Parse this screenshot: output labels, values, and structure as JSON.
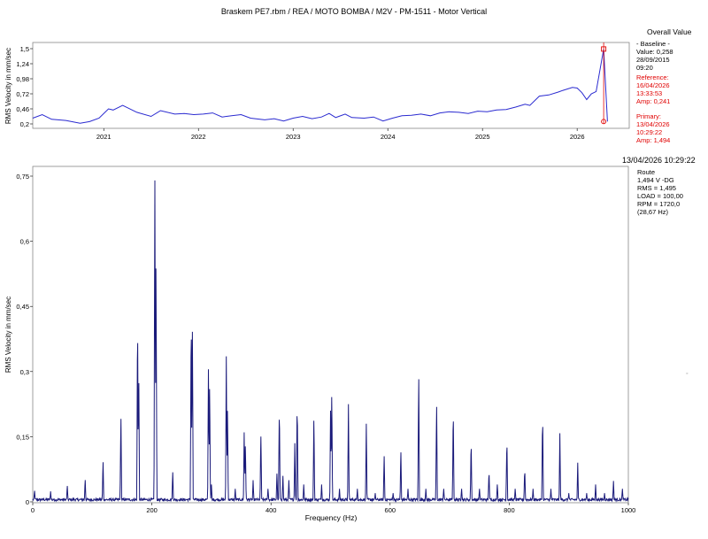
{
  "window_title": "Braskem PE7.rbm / REA / MOTO BOMBA / M2V - PM-1511 - Motor Vertical",
  "overall_label": "Overall Value",
  "baseline": {
    "title": "- Baseline -",
    "value": "Value: 0,258",
    "date": "28/09/2015",
    "time": "09:20"
  },
  "reference": {
    "title": "Reference:",
    "date": "16/04/2026",
    "time": "13:33:53",
    "amp": "Amp: 0,241"
  },
  "primary": {
    "title": "Primary:",
    "date": "13/04/2026",
    "time": "10:29:22",
    "amp": "Amp: 1,494"
  },
  "spectrum_timestamp": "13/04/2026 10:29:22",
  "spectrum_info": {
    "line1": "Route",
    "line2": "1,494 V -DG",
    "line3": "RMS = 1,495",
    "line4": "LOAD = 100,00",
    "line5": "RPM = 1720,0",
    "line6": "(28,67 Hz)"
  },
  "colors": {
    "trend_line": "#2a2ad0",
    "spectrum_line": "#1a1a7a",
    "marker": "#e00000",
    "reference_text": "#e00000"
  },
  "chart_data": [
    {
      "type": "line",
      "ylabel": "RMS Velocity in mm/sec",
      "ylim": [
        0.2,
        1.5
      ],
      "yticks": [
        "1,5",
        "1,24",
        "0,98",
        "0,72",
        "0,46",
        "0,2"
      ],
      "ytick_values": [
        1.5,
        1.24,
        0.98,
        0.72,
        0.46,
        0.2
      ],
      "xlim": [
        2020.25,
        2026.55
      ],
      "xticks": [
        "2021",
        "2022",
        "2023",
        "2024",
        "2025",
        "2026"
      ],
      "xtick_values": [
        2021,
        2022,
        2023,
        2024,
        2025,
        2026
      ],
      "x": [
        2020.25,
        2020.35,
        2020.45,
        2020.6,
        2020.75,
        2020.85,
        2020.95,
        2021.05,
        2021.1,
        2021.2,
        2021.35,
        2021.5,
        2021.6,
        2021.75,
        2021.85,
        2021.95,
        2022.05,
        2022.15,
        2022.25,
        2022.35,
        2022.45,
        2022.55,
        2022.7,
        2022.8,
        2022.9,
        2023.0,
        2023.1,
        2023.2,
        2023.3,
        2023.38,
        2023.45,
        2023.55,
        2023.62,
        2023.75,
        2023.85,
        2023.95,
        2024.05,
        2024.15,
        2024.25,
        2024.35,
        2024.45,
        2024.55,
        2024.65,
        2024.75,
        2024.85,
        2024.95,
        2025.05,
        2025.15,
        2025.25,
        2025.35,
        2025.45,
        2025.5,
        2025.6,
        2025.7,
        2025.8,
        2025.85,
        2025.95,
        2026.0,
        2026.05,
        2026.1,
        2026.15,
        2026.2,
        2026.28,
        2026.32
      ],
      "values": [
        0.3,
        0.36,
        0.28,
        0.26,
        0.21,
        0.24,
        0.3,
        0.46,
        0.44,
        0.52,
        0.4,
        0.33,
        0.43,
        0.37,
        0.38,
        0.36,
        0.37,
        0.39,
        0.32,
        0.34,
        0.36,
        0.3,
        0.27,
        0.29,
        0.25,
        0.3,
        0.33,
        0.29,
        0.32,
        0.38,
        0.31,
        0.37,
        0.31,
        0.3,
        0.32,
        0.25,
        0.3,
        0.34,
        0.35,
        0.37,
        0.34,
        0.39,
        0.41,
        0.4,
        0.38,
        0.42,
        0.41,
        0.44,
        0.45,
        0.49,
        0.54,
        0.52,
        0.68,
        0.7,
        0.75,
        0.78,
        0.83,
        0.82,
        0.74,
        0.62,
        0.72,
        0.76,
        1.494,
        0.241
      ],
      "baseline_value": 0.258
    },
    {
      "type": "line",
      "xlabel": "Frequency (Hz)",
      "ylabel": "RMS Velocity in mm/sec",
      "xlim": [
        0,
        1000
      ],
      "ylim": [
        0,
        0.75
      ],
      "xticks": [
        "0",
        "200",
        "400",
        "600",
        "800",
        "1000"
      ],
      "xtick_values": [
        0,
        200,
        400,
        600,
        800,
        1000
      ],
      "yticks": [
        "0,75",
        "0,6",
        "0,45",
        "0,3",
        "0,15",
        "0"
      ],
      "ytick_values": [
        0.75,
        0.6,
        0.45,
        0.3,
        0.15,
        0
      ],
      "peaks": [
        [
          3,
          0.028
        ],
        [
          30,
          0.024
        ],
        [
          58,
          0.04
        ],
        [
          88,
          0.055
        ],
        [
          118,
          0.1
        ],
        [
          148,
          0.21
        ],
        [
          176,
          0.445
        ],
        [
          178,
          0.3
        ],
        [
          205,
          0.74
        ],
        [
          207,
          0.59
        ],
        [
          235,
          0.068
        ],
        [
          266,
          0.455
        ],
        [
          268,
          0.43
        ],
        [
          295,
          0.305
        ],
        [
          297,
          0.285
        ],
        [
          325,
          0.335
        ],
        [
          327,
          0.23
        ],
        [
          355,
          0.16
        ],
        [
          357,
          0.14
        ],
        [
          383,
          0.165
        ],
        [
          410,
          0.065
        ],
        [
          414,
          0.23
        ],
        [
          440,
          0.135
        ],
        [
          444,
          0.24
        ],
        [
          472,
          0.205
        ],
        [
          500,
          0.21
        ],
        [
          502,
          0.265
        ],
        [
          530,
          0.225
        ],
        [
          560,
          0.18
        ],
        [
          590,
          0.105
        ],
        [
          618,
          0.125
        ],
        [
          648,
          0.31
        ],
        [
          678,
          0.24
        ],
        [
          706,
          0.225
        ],
        [
          736,
          0.148
        ],
        [
          766,
          0.075
        ],
        [
          796,
          0.152
        ],
        [
          826,
          0.08
        ],
        [
          856,
          0.21
        ],
        [
          885,
          0.158
        ],
        [
          915,
          0.09
        ],
        [
          945,
          0.04
        ],
        [
          975,
          0.048
        ],
        [
          268,
          0.02
        ],
        [
          300,
          0.04
        ],
        [
          340,
          0.03
        ],
        [
          370,
          0.05
        ],
        [
          395,
          0.03
        ],
        [
          420,
          0.06
        ],
        [
          430,
          0.05
        ],
        [
          455,
          0.04
        ],
        [
          485,
          0.04
        ],
        [
          515,
          0.03
        ],
        [
          545,
          0.03
        ],
        [
          575,
          0.02
        ],
        [
          605,
          0.02
        ],
        [
          630,
          0.03
        ],
        [
          660,
          0.03
        ],
        [
          690,
          0.03
        ],
        [
          720,
          0.03
        ],
        [
          750,
          0.03
        ],
        [
          780,
          0.04
        ],
        [
          810,
          0.03
        ],
        [
          840,
          0.03
        ],
        [
          870,
          0.03
        ],
        [
          900,
          0.02
        ],
        [
          930,
          0.02
        ],
        [
          960,
          0.02
        ],
        [
          990,
          0.03
        ]
      ]
    }
  ]
}
